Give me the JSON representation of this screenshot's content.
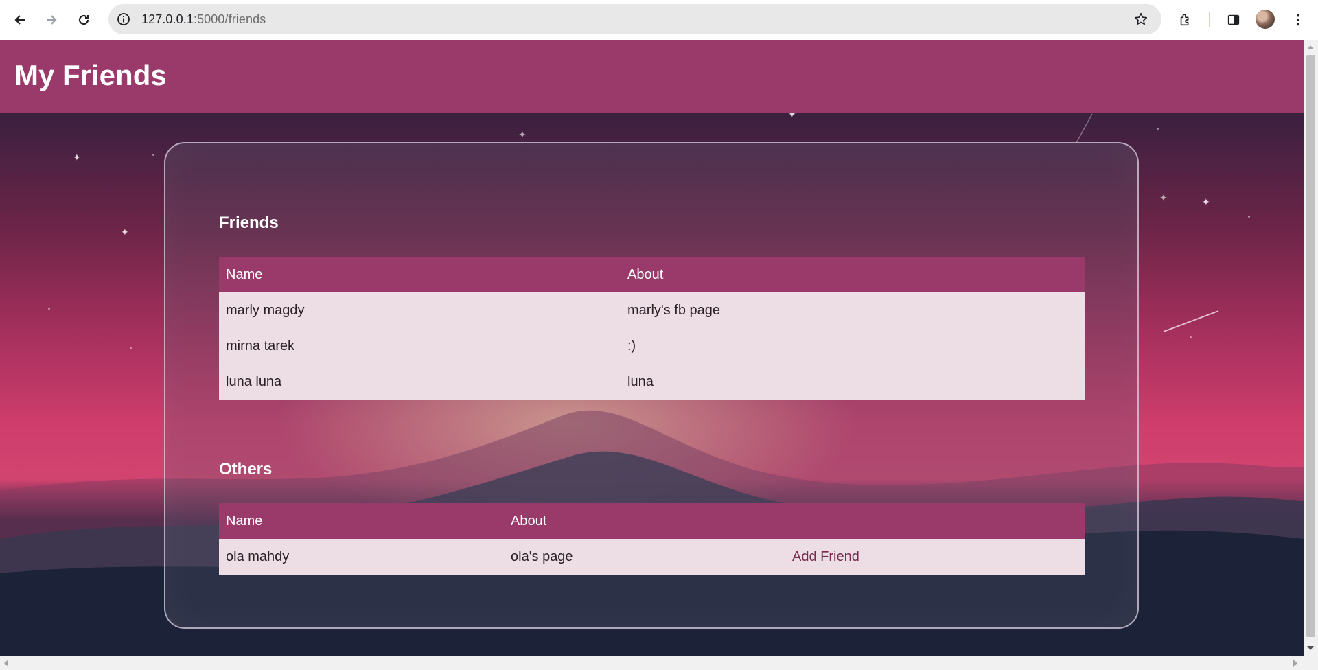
{
  "browser": {
    "url_host": "127.0.0.1",
    "url_path": ":5000/friends"
  },
  "header": {
    "title": "My Friends"
  },
  "friends_section": {
    "title": "Friends",
    "columns": [
      "Name",
      "About"
    ],
    "rows": [
      {
        "name": "marly magdy",
        "about": "marly's fb page"
      },
      {
        "name": "mirna tarek",
        "about": ":)"
      },
      {
        "name": "luna luna",
        "about": "luna"
      }
    ]
  },
  "others_section": {
    "title": "Others",
    "columns": [
      "Name",
      "About",
      ""
    ],
    "rows": [
      {
        "name": "ola mahdy",
        "about": "ola's page",
        "action": "Add Friend"
      }
    ]
  },
  "colors": {
    "header_bg": "#9a3a6b",
    "row_bg": "#ecdee4",
    "link": "#7a2a4c"
  }
}
